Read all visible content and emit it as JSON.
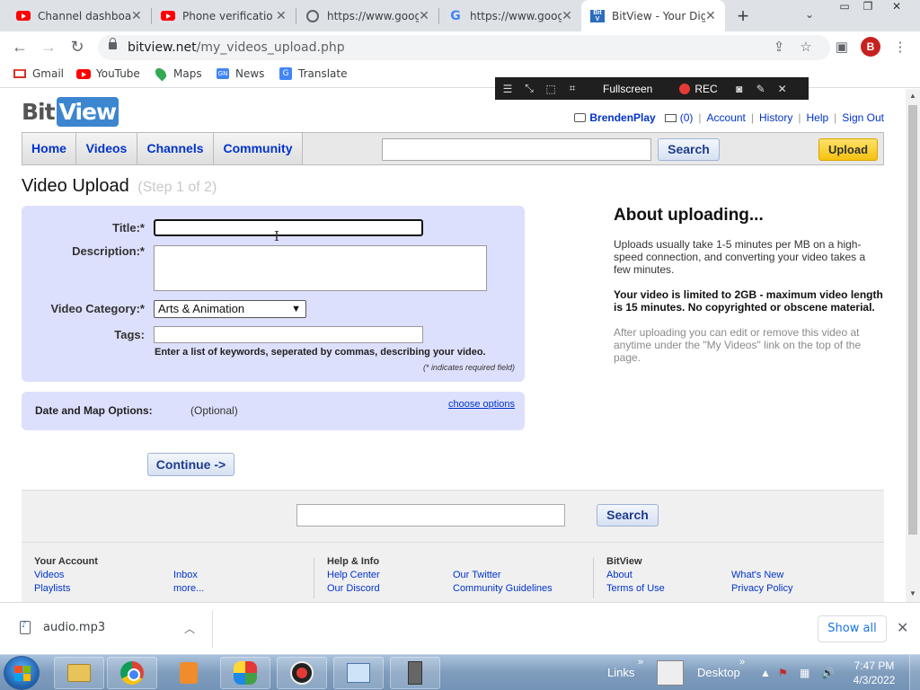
{
  "browser": {
    "tabs": [
      {
        "title": "Channel dashboar",
        "favicon": "youtube-icon",
        "active": false
      },
      {
        "title": "Phone verificatio",
        "favicon": "youtube-icon",
        "active": false
      },
      {
        "title": "https://www.goog",
        "favicon": "globe-icon",
        "active": false
      },
      {
        "title": "https://www.goog",
        "favicon": "google-icon",
        "active": false
      },
      {
        "title": "BitView - Your Dig",
        "favicon": "bitview-icon",
        "active": true
      }
    ],
    "url_domain": "bitview.net",
    "url_path": "/my_videos_upload.php",
    "profile_initial": "B",
    "bookmarks": [
      "Gmail",
      "YouTube",
      "Maps",
      "News",
      "Translate"
    ]
  },
  "recorder": {
    "fullscreen_label": "Fullscreen",
    "rec_label": "REC"
  },
  "site": {
    "logo_bit": "Bit",
    "logo_view": "View",
    "username": "BrendenPlay",
    "inbox_count": "(0)",
    "user_links": [
      "Account",
      "History",
      "Help",
      "Sign Out"
    ],
    "nav": [
      "Home",
      "Videos",
      "Channels",
      "Community"
    ],
    "search_button": "Search",
    "upload_button": "Upload"
  },
  "upload": {
    "title": "Video Upload",
    "step": "(Step 1 of 2)",
    "labels": {
      "title": "Title:*",
      "description": "Description:*",
      "category": "Video Category:*",
      "tags": "Tags:"
    },
    "title_value": "",
    "description_value": "",
    "category_value": "Arts & Animation",
    "tags_value": "",
    "tags_hint": "Enter a list of keywords, seperated by commas, describing your video.",
    "required_note": "(* indicates required field)",
    "date_map_label": "Date and Map Options:",
    "optional_label": "(Optional)",
    "choose_options": "choose options",
    "continue_button": "Continue ->"
  },
  "about": {
    "heading": "About uploading...",
    "p1": "Uploads usually take 1-5 minutes per MB on a high-speed connection, and converting your video takes a few minutes.",
    "p2": "Your video is limited to 2GB - maximum video length is 15 minutes. No copyrighted or obscene material.",
    "p3": "After uploading you can edit or remove this video at anytime under the \"My Videos\" link on the top of the page."
  },
  "footer": {
    "search_button": "Search",
    "col1": {
      "heading": "Your Account",
      "links": [
        "Videos",
        "Playlists",
        "Inbox",
        "more..."
      ]
    },
    "col2": {
      "heading": "Help & Info",
      "links": [
        "Help Center",
        "Our Discord",
        "Our Twitter",
        "Community Guidelines"
      ]
    },
    "col3": {
      "heading": "BitView",
      "links": [
        "About",
        "Terms of Use",
        "What's New",
        "Privacy Policy"
      ]
    }
  },
  "downloads": {
    "file": "audio.mp3",
    "show_all": "Show all"
  },
  "taskbar": {
    "links_label": "Links",
    "desktop_label": "Desktop",
    "time": "7:47 PM",
    "date": "4/3/2022"
  },
  "colors": {
    "form_bg": "#dde0fc",
    "link": "#0033cc",
    "upload_btn": "#f5c20f",
    "logo_blue": "#3c86d0"
  }
}
